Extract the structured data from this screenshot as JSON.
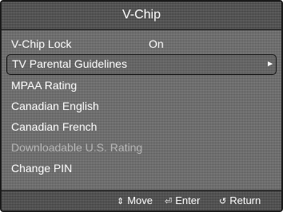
{
  "title": "V-Chip",
  "menu": {
    "items": [
      {
        "label": "V-Chip Lock",
        "value": "On"
      },
      {
        "label": "TV Parental Guidelines",
        "arrow": "►"
      },
      {
        "label": "MPAA Rating"
      },
      {
        "label": "Canadian English"
      },
      {
        "label": "Canadian French"
      },
      {
        "label": "Downloadable U.S. Rating"
      },
      {
        "label": "Change PIN"
      }
    ]
  },
  "footer": {
    "move_icon": "⇕",
    "move_label": "Move",
    "enter_icon": "⏎",
    "enter_label": "Enter",
    "return_icon": "↺",
    "return_label": "Return"
  },
  "colors": {
    "background": "#6a6a6a",
    "bar": "#4a4a4a",
    "text": "#ffffff",
    "disabled_text": "#b8b8b8",
    "selection_border": "#111111"
  },
  "icons": [
    "move-icon",
    "enter-icon",
    "return-icon",
    "arrow-right-icon"
  ]
}
